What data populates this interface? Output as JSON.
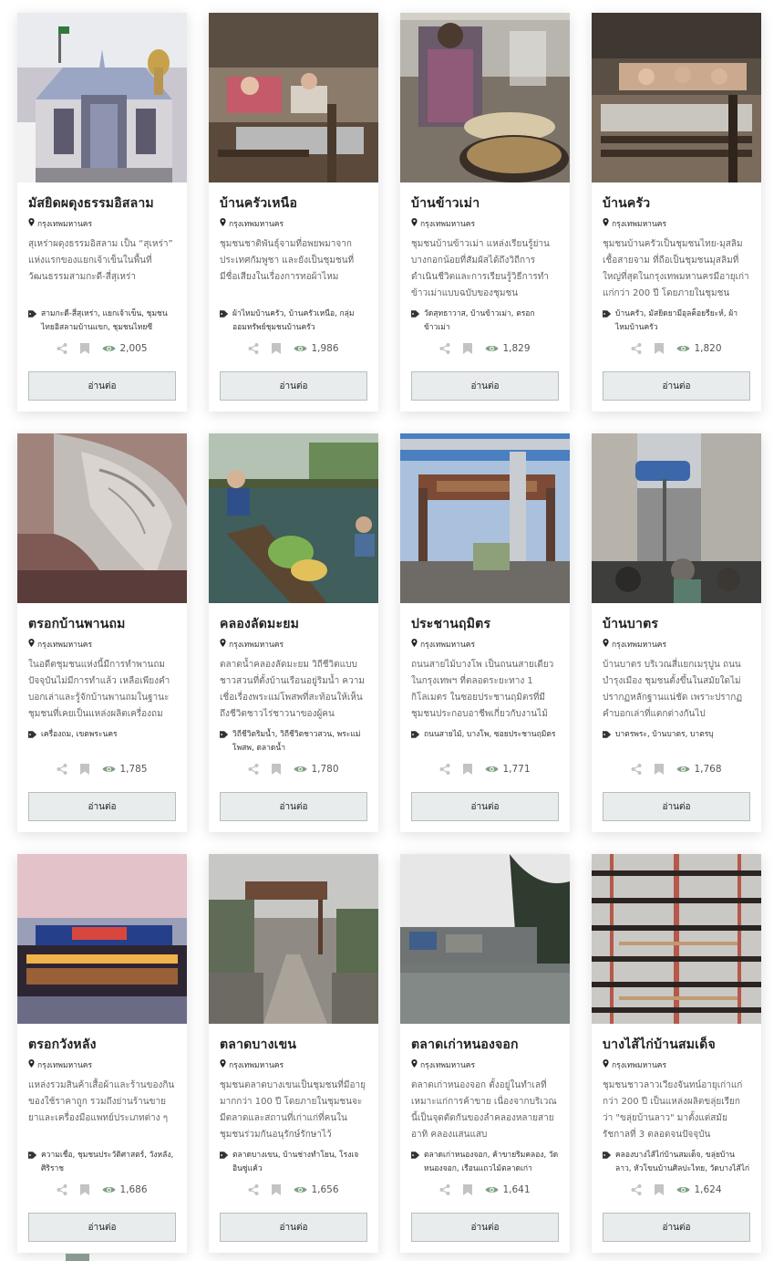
{
  "cards": [
    {
      "title": "มัสยิดผดุงธรรมอิสลาม",
      "location": "กรุงเทพมหานคร",
      "desc": "สุเหร่าผดุงธรรมอิสลาม เป็น “สุเหร่า” แห่งแรกของแยกเจ้าเข็นในพื้นที่วัฒนธรรมสามกะดี-สี่สุเหร่า",
      "tags": "สามกะดี-สี่สุเหร่า, แยกเจ้าเข็น, ชุมชนไทยอิสลามบ้านแขก, ชุมชนไทยซีอะห์อิษนาอะชะรี, สัปปุรุษ",
      "views": "2,005",
      "read": "อ่านต่อ",
      "img": "mosque"
    },
    {
      "title": "บ้านครัวเหนือ",
      "location": "กรุงเทพมหานคร",
      "desc": "ชุมชนชาติพันธุ์จามที่อพยพมาจากประเทศกัมพูชา และยังเป็นชุมชนที่มีชื่อเสียงในเรื่องการทอผ้าไหม",
      "tags": "ผ้าไหมบ้านครัว, บ้านครัวเหนือ, กลุ่มออมทรัพย์ชุมชนบ้านครัว",
      "views": "1,986",
      "read": "อ่านต่อ",
      "img": "weaving"
    },
    {
      "title": "บ้านข้าวเม่า",
      "location": "กรุงเทพมหานคร",
      "desc": "ชุมชนบ้านข้าวเม่า แหล่งเรียนรู้ย่านบางกอกน้อยที่สัมผัสได้ถึงวิถีการดำเนินชีวิตและการเรียนรู้วิธีการทำข้าวเม่าแบบฉบับของชุมชน",
      "tags": "วัดสุทธาวาส, บ้านข้าวเม่า, ตรอกข้าวเม่า",
      "views": "1,829",
      "read": "อ่านต่อ",
      "img": "ricecook"
    },
    {
      "title": "บ้านครัว",
      "location": "กรุงเทพมหานคร",
      "desc": "ชุมชนบ้านครัวเป็นชุมชนไทย-มุสลิมเชื้อสายจาม ที่ถือเป็นชุมชนมุสลิมที่ใหญ่ที่สุดในกรุงเทพมหานครมีอายุเก่าแก่กว่า 200 ปี โดยภายในชุมชน",
      "tags": "บ้านครัว, มัสยิดยามีอุลค็อยรียะห์, ผ้าไหมบ้านครัว",
      "views": "1,820",
      "read": "อ่านต่อ",
      "img": "loom"
    },
    {
      "title": "ตรอกบ้านพานถม",
      "location": "กรุงเทพมหานคร",
      "desc": "ในอดีตชุมชนแห่งนี้มีการทำพานถม ปัจจุบันไม่มีการทำแล้ว เหลือเพียงคำบอกเล่าและรู้จักบ้านพานถมในฐานะชุมชนที่เคยเป็นแหล่งผลิตเครื่องถม",
      "tags": "เครื่องถม, เขตพระนคร",
      "views": "1,785",
      "read": "อ่านต่อ",
      "img": "silver"
    },
    {
      "title": "คลองลัดมะยม",
      "location": "กรุงเทพมหานคร",
      "desc": "ตลาดน้ำคลองลัดมะยม วิถีชีวิตแบบชาวสวนที่ตั้งบ้านเรือนอยู่ริมน้ำ ความเชื่อเรื่องพระแม่โพสพที่สะท้อนให้เห็นถึงชีวิตชาวไร่ชาวนาของผู้คน",
      "tags": "วิถีชีวิตริมน้ำ, วิถีชีวิตชาวสวน, พระแม่โพสพ, ตลาดน้ำ",
      "views": "1,780",
      "read": "อ่านต่อ",
      "img": "market"
    },
    {
      "title": "ประชานฤมิตร",
      "location": "กรุงเทพมหานคร",
      "desc": "ถนนสายไม้บางโพ เป็นถนนสายเดียวในกรุงเทพฯ ที่ตลอดระยะทาง 1 กิโลเมตร ในซอยประชานฤมิตรที่มีชุมชนประกอบอาชีพเกี่ยวกับงานไม้",
      "tags": "ถนนสายไม้, บางโพ, ซอยประชานฤมิตร",
      "views": "1,771",
      "read": "อ่านต่อ",
      "img": "gate"
    },
    {
      "title": "บ้านบาตร",
      "location": "กรุงเทพมหานคร",
      "desc": "บ้านบาตร บริเวณสี่แยกเมรุปูน ถนนบำรุงเมือง ชุมชนตั้งขึ้นในสมัยใดไม่ปรากฏหลักฐานแน่ชัด เพราะปรากฏคำบอกเล่าที่แตกต่างกันไป",
      "tags": "บาตรพระ, บ้านบาตร, บาตรบุ",
      "views": "1,768",
      "read": "อ่านต่อ",
      "img": "street"
    },
    {
      "title": "ตรอกวังหลัง",
      "location": "กรุงเทพมหานคร",
      "desc": "แหล่งรวมสินค้าเสื้อผ้าและร้านของกินของใช้ราคาถูก รวมถึงย่านร้านขายยาและเครื่องมือแพทย์ประเภทต่าง ๆ",
      "tags": "ความเชื่อ, ชุมชนประวัติศาสตร์, วังหลัง, ศิริราช",
      "views": "1,686",
      "read": "อ่านต่อ",
      "img": "pier"
    },
    {
      "title": "ตลาดบางเขน",
      "location": "กรุงเทพมหานคร",
      "desc": "ชุมชนตลาดบางเขนเป็นชุมชนที่มีอายุมากกว่า 100 ปี โดยภายในชุมชนจะมีตลาดและสถานที่เก่าแก่ที่คนในชุมชนร่วมกันอนุรักษ์รักษาไว้",
      "tags": "ตลาดบางเขน, บ้านช่างทำโยน, โรงเจอินซู่แค้ว",
      "views": "1,656",
      "read": "อ่านต่อ",
      "img": "walkway"
    },
    {
      "title": "ตลาดเก่าหนองจอก",
      "location": "กรุงเทพมหานคร",
      "desc": "ตลาดเก่าหนองจอก ตั้งอยู่ในทำเลที่เหมาะแก่การค้าขาย เนื่องจากบริเวณนี้เป็นจุดตัดกันของลำคลองหลายสาย อาทิ คลองแสนแสบ",
      "tags": "ตลาดเก่าหนองจอก, ค้าขายริมคลอง, วัดหนองจอก, เรือนแถวไม้ตลาดเก่าหนองจอก",
      "views": "1,641",
      "read": "อ่านต่อ",
      "img": "canal"
    },
    {
      "title": "บางไส้ไก่บ้านสมเด็จ",
      "location": "กรุงเทพมหานคร",
      "desc": "ชุมชนชาวลาวเวียงจันทน์อายุเก่าแก่กว่า 200 ปี เป็นแหล่งผลิตขลุ่ยเรียกว่า \"ขลุ่ยบ้านลาว\" มาตั้งแต่สมัยรัชกาลที่ 3 ตลอดจนปัจจุบัน",
      "tags": "คลองบางไส้ไก่บ้านสมเด็จ, ขลุ่ยบ้านลาว, หัวโขนบ้านศิลปะไทย, วัดบางไส้ไก่",
      "views": "1,624",
      "read": "อ่านต่อ",
      "img": "flutes"
    }
  ],
  "colors": {
    "accent": "#7fa083",
    "button_bg": "#e8ecec",
    "button_border": "#b7bebd",
    "eye": "#7fa083",
    "muted_icon": "#bbbbbb"
  }
}
